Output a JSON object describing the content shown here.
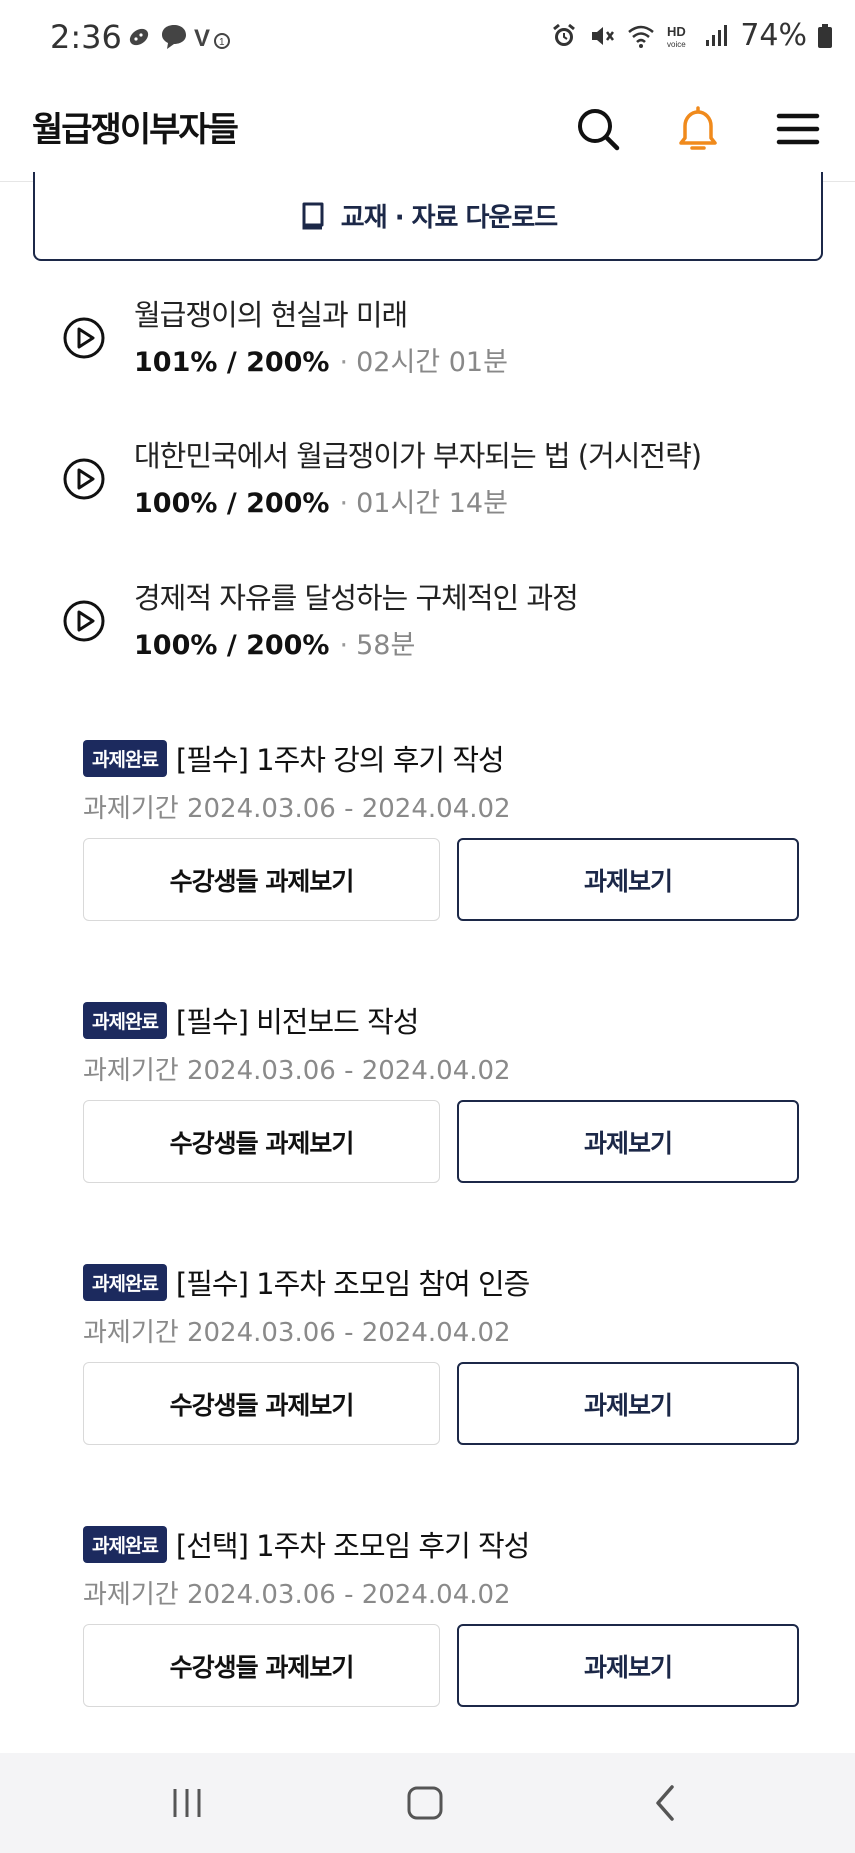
{
  "status_bar": {
    "time": "2:36",
    "battery": "74%",
    "left_icons": [
      "running-app-icon",
      "chat-bubble-icon",
      "volte-icon"
    ],
    "right_icons": [
      "alarm-icon",
      "mute-icon",
      "wifi-icon",
      "hd-voice-icon",
      "signal-icon",
      "battery-icon"
    ]
  },
  "header": {
    "brand": "월급쟁이부자들",
    "accent_color": "#f08a1c",
    "icons": [
      "search-icon",
      "bell-icon",
      "menu-icon"
    ]
  },
  "download": {
    "label": "교재 · 자료 다운로드",
    "icon": "book-icon"
  },
  "lectures": [
    {
      "title": "월급쟁이의 현실과 미래",
      "progress": "101% / 200%",
      "separator": "·",
      "duration": "02시간 01분"
    },
    {
      "title": "대한민국에서 월급쟁이가 부자되는 법 (거시전략)",
      "progress": "100% / 200%",
      "separator": "·",
      "duration": "01시간 14분"
    },
    {
      "title": "경제적 자유를 달성하는 구체적인 과정",
      "progress": "100% / 200%",
      "separator": "·",
      "duration": "58분"
    }
  ],
  "assignments": [
    {
      "badge": "과제완료",
      "title": "[필수] 1주차 강의 후기 작성",
      "period": "과제기간 2024.03.06 - 2024.04.02",
      "students_button": "수강생들 과제보기",
      "view_button": "과제보기"
    },
    {
      "badge": "과제완료",
      "title": "[필수] 비전보드 작성",
      "period": "과제기간 2024.03.06 - 2024.04.02",
      "students_button": "수강생들 과제보기",
      "view_button": "과제보기"
    },
    {
      "badge": "과제완료",
      "title": "[필수] 1주차 조모임 참여 인증",
      "period": "과제기간 2024.03.06 - 2024.04.02",
      "students_button": "수강생들 과제보기",
      "view_button": "과제보기"
    },
    {
      "badge": "과제완료",
      "title": "[선택] 1주차 조모임 후기 작성",
      "period": "과제기간 2024.03.06 - 2024.04.02",
      "students_button": "수강생들 과제보기",
      "view_button": "과제보기"
    }
  ],
  "nav_bar": {
    "icons": [
      "recent-apps-icon",
      "home-icon",
      "back-icon"
    ]
  },
  "colors": {
    "navy": "#1c2848",
    "badge_bg": "#1c2a5e",
    "bell": "#f08a1c"
  }
}
